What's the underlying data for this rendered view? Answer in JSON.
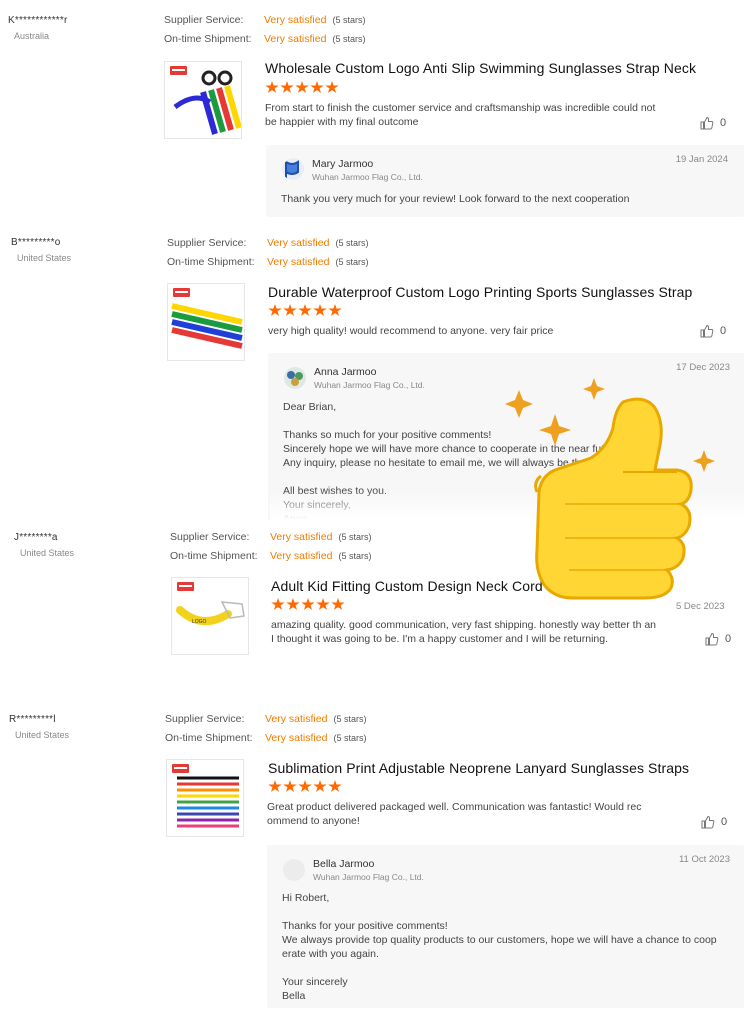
{
  "labels": {
    "supplier_service": "Supplier Service:",
    "ontime_shipment": "On-time Shipment:",
    "rating_value": "Very satisfied",
    "rating_stars": "(5 stars)"
  },
  "colors": {
    "accent": "#ff6a00",
    "rating_text": "#f07c00",
    "reply_bg": "#f7f7f7"
  },
  "reviews": [
    {
      "buyer": "K************r",
      "country": "Australia",
      "product_title": "Wholesale Custom Logo Anti Slip Swimming Sunglasses Strap Neck",
      "comment": "From start to finish the customer service and craftsmanship was incredible could not be happier with my final outcome",
      "likes": "0",
      "reply": {
        "name": "Mary Jarmoo",
        "company": "Wuhan Jarmoo Flag Co., Ltd.",
        "date": "19 Jan 2024",
        "text": "Thank you very much for your review! Look forward to the next cooperation"
      }
    },
    {
      "buyer": "B*********o",
      "country": "United States",
      "product_title": "Durable Waterproof Custom Logo Printing Sports Sunglasses Strap",
      "comment": "very high quality! would recommend to anyone. very fair price",
      "likes": "0",
      "reply": {
        "name": "Anna Jarmoo",
        "company": "Wuhan Jarmoo Flag Co., Ltd.",
        "date": "17 Dec 2023",
        "text": "Dear Brian,\n\nThanks so much for your positive comments!\nSincerely hope we will have more chance to cooperate in the near future\nAny inquiry, please no hesitate to email me, we will always be there for you !\n\nAll best wishes to you.\nYour sincerely,\nAnna"
      }
    },
    {
      "buyer": "J********a",
      "country": "United States",
      "product_title": "Adult Kid Fitting Custom Design Neck Cord R... Eyewear",
      "comment": "amazing quality. good communication, very fast shipping.  honestly way better th an I thought it was going to be. I'm a happy customer and I will be returning.",
      "date": "5 Dec 2023",
      "likes": "0"
    },
    {
      "buyer": "R*********l",
      "country": "United States",
      "product_title": "Sublimation Print Adjustable Neoprene Lanyard Sunglasses Straps",
      "comment": "Great product delivered packaged well.  Communication was fantastic!  Would rec ommend to anyone!",
      "likes": "0",
      "reply": {
        "name": "Bella Jarmoo",
        "company": "Wuhan Jarmoo Flag Co., Ltd.",
        "date": "11 Oct 2023",
        "text": "Hi Robert,\n\nThanks for your positive comments!\nWe always provide top quality products to our customers, hope we will have a chance to coop erate with you again.\n\nYour sincerely\nBella"
      }
    }
  ]
}
